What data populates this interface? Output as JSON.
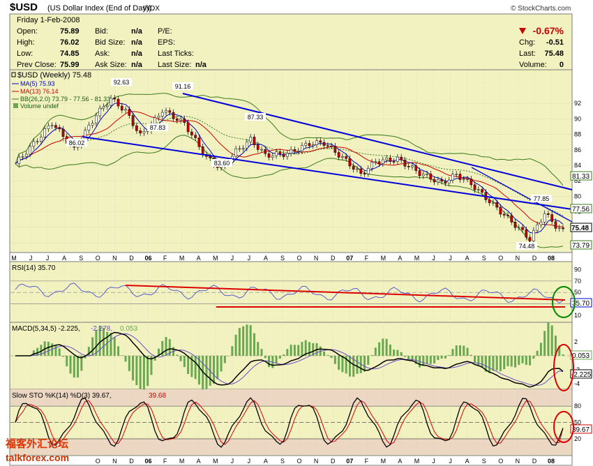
{
  "header": {
    "symbol": "$USD",
    "name": "(US Dollar Index (End of Day))",
    "exchange": "INDX",
    "source": "© StockCharts.com"
  },
  "quote": {
    "date": "Friday  1-Feb-2008",
    "open_label": "Open:",
    "open": "75.89",
    "high_label": "High:",
    "high": "76.02",
    "low_label": "Low:",
    "low": "74.85",
    "prevclose_label": "Prev Close:",
    "prevclose": "75.99",
    "bid_label": "Bid:",
    "bid": "n/a",
    "bidsize_label": "Bid Size:",
    "bidsize": "n/a",
    "ask_label": "Ask:",
    "ask": "n/a",
    "asksize_label": "Ask Size:",
    "asksize": "n/a",
    "pe_label": "P/E:",
    "eps_label": "EPS:",
    "lastticks_label": "Last Ticks:",
    "lastsize_label": "Last Size:",
    "lastsize": "n/a",
    "change_pct": "-0.67%",
    "chg_label": "Chg:",
    "chg": "-0.51",
    "last_label": "Last:",
    "last": "75.48",
    "volume_label": "Volume:",
    "volume": "0"
  },
  "colors": {
    "panel_bg": "#f2f2c0",
    "border": "#7a7a7a",
    "up": "#ffffff",
    "down": "#cc0000",
    "ma5": "#0000cc",
    "ma13": "#cc0000",
    "bollinger": "#3a7a1a",
    "trendline": "#0000dd",
    "macd_hist": "#6aa84f",
    "macd_signal": "#6a4cc8",
    "annotation_red": "#dd0000",
    "annotation_green": "#008800"
  },
  "legend": {
    "price": "$USD (Weekly) 75.48",
    "ma5": "MA(5) 75.93",
    "ma13": "MA(13) 76.14",
    "bb": "BB(26,2.0) 73.79 - 77.56 - 81.33",
    "volume": "Volume undef"
  },
  "rsi_legend": "RSI(14) 35.70",
  "macd_legend_a": "MACD(5,34,5) -2.225,",
  "macd_legend_b": "-2.278,",
  "macd_legend_c": "0.053",
  "sto_legend_a": "Slow STO %K(14) %D(3) 39.67,",
  "sto_legend_b": "39.68",
  "top_xaxis": [
    "M",
    "J",
    "J",
    "A",
    "S",
    "O",
    "N",
    "D",
    "06",
    "F",
    "M",
    "A",
    "M",
    "J",
    "J",
    "A",
    "S",
    "O",
    "N",
    "D",
    "07",
    "F",
    "M",
    "A",
    "M",
    "J",
    "J",
    "A",
    "S",
    "O",
    "N",
    "D",
    "08"
  ],
  "bottom_xaxis": [
    "O",
    "N",
    "D",
    "06",
    "F",
    "M",
    "A",
    "M",
    "J",
    "J",
    "A",
    "S",
    "O",
    "N",
    "D",
    "07",
    "F",
    "M",
    "A",
    "M",
    "J",
    "J",
    "A",
    "S",
    "O",
    "N",
    "D",
    "08"
  ],
  "price_ticks": [
    "92",
    "90",
    "88",
    "86",
    "84",
    "82",
    "80",
    "78",
    "76",
    "74"
  ],
  "rsi_ticks": [
    "90",
    "70",
    "50",
    "30",
    "10"
  ],
  "macd_ticks": [
    "2",
    "0",
    "-2",
    "-4"
  ],
  "sto_ticks": [
    "80",
    "50",
    "20"
  ],
  "rsi_value_tag": "35.70",
  "macd_hist_tag": "0.053",
  "macd_value_tag": "-2.225",
  "sto_value_tag": "39.67",
  "price_tags": {
    "bb_upper": "81.33",
    "bb_mid": "77.56",
    "last": "75.48",
    "bb_lower": "73.79"
  },
  "annotations": [
    "92.63",
    "91.16",
    "87.83",
    "87.33",
    "86.02",
    "83.60",
    "77.85",
    "74.48"
  ],
  "watermark": {
    "cn": "福客外汇论坛",
    "url": "talkforex.com"
  },
  "chart_data": {
    "type": "line",
    "title": "$USD (US Dollar Index (End of Day))",
    "ylim": [
      73,
      94
    ],
    "key_points": [
      {
        "label": "86.02",
        "value": 86.02
      },
      {
        "label": "92.63",
        "value": 92.63
      },
      {
        "label": "91.16",
        "value": 91.16
      },
      {
        "label": "87.83",
        "value": 87.83
      },
      {
        "label": "83.60",
        "value": 83.6
      },
      {
        "label": "87.33",
        "value": 87.33
      },
      {
        "label": "74.48",
        "value": 74.48
      },
      {
        "label": "77.85",
        "value": 77.85
      },
      {
        "label": "Last",
        "value": 75.48
      }
    ],
    "series": [
      {
        "name": "MA(5)",
        "last": 75.93
      },
      {
        "name": "MA(13)",
        "last": 76.14
      },
      {
        "name": "BB(26,2.0)",
        "lower": 73.79,
        "mid": 77.56,
        "upper": 81.33
      },
      {
        "name": "RSI(14)",
        "last": 35.7
      },
      {
        "name": "MACD(5,34,5)",
        "macd": -2.225,
        "signal": -2.278,
        "histogram": 0.053
      },
      {
        "name": "Slow STO %K(14) %D(3)",
        "k": 39.67,
        "d": 39.68
      }
    ]
  }
}
